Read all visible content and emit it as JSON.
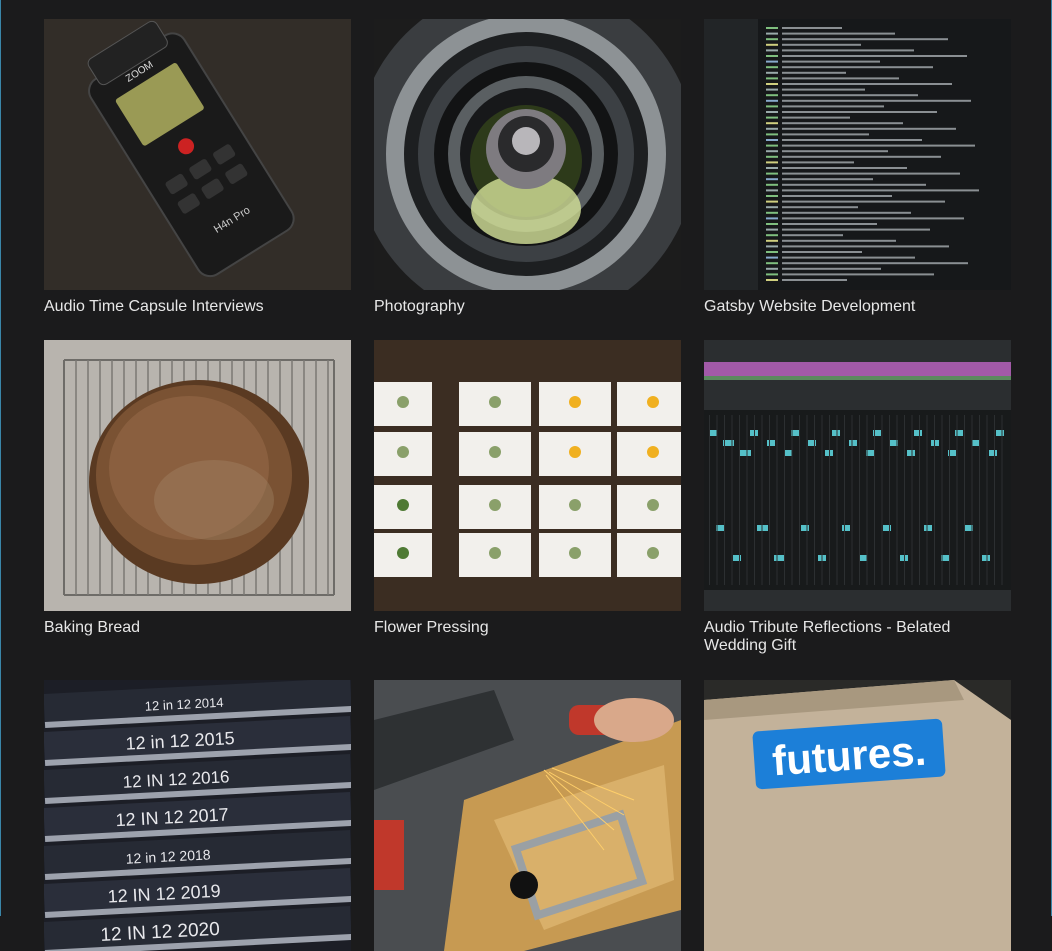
{
  "gallery": {
    "items": [
      {
        "title": "Audio Time Capsule Interviews",
        "image": "handheld-audio-recorder",
        "recorder": {
          "brand": "ZOOM",
          "model": "H4n Pro"
        }
      },
      {
        "title": "Photography",
        "image": "camera-lens-closeup"
      },
      {
        "title": "Gatsby Website Development",
        "image": "terminal-output"
      },
      {
        "title": "Baking Bread",
        "image": "sourdough-loaf-on-rack"
      },
      {
        "title": "Flower Pressing",
        "image": "pressed-flowers-on-cards"
      },
      {
        "title": "Audio Tribute Reflections - Belated Wedding Gift",
        "image": "audio-editing-timeline"
      },
      {
        "title": "",
        "image": "stacked-bound-books",
        "spines": [
          "12 in 12 2014",
          "12 in 12 2015",
          "12 IN 12 2016",
          "12 IN 12 2017",
          "12 in 12 2018",
          "12 IN 12 2019",
          "12 IN 12 2020"
        ]
      },
      {
        "title": "",
        "image": "metal-grinding-sparks"
      },
      {
        "title": "",
        "image": "futures-sticker-on-notebook",
        "sticker_text": "futures."
      }
    ]
  },
  "colors": {
    "background": "#1b1b1c",
    "caption": "#e7e7e7",
    "frame": "#3a86a8",
    "sticker_blue": "#1c7fd8"
  }
}
